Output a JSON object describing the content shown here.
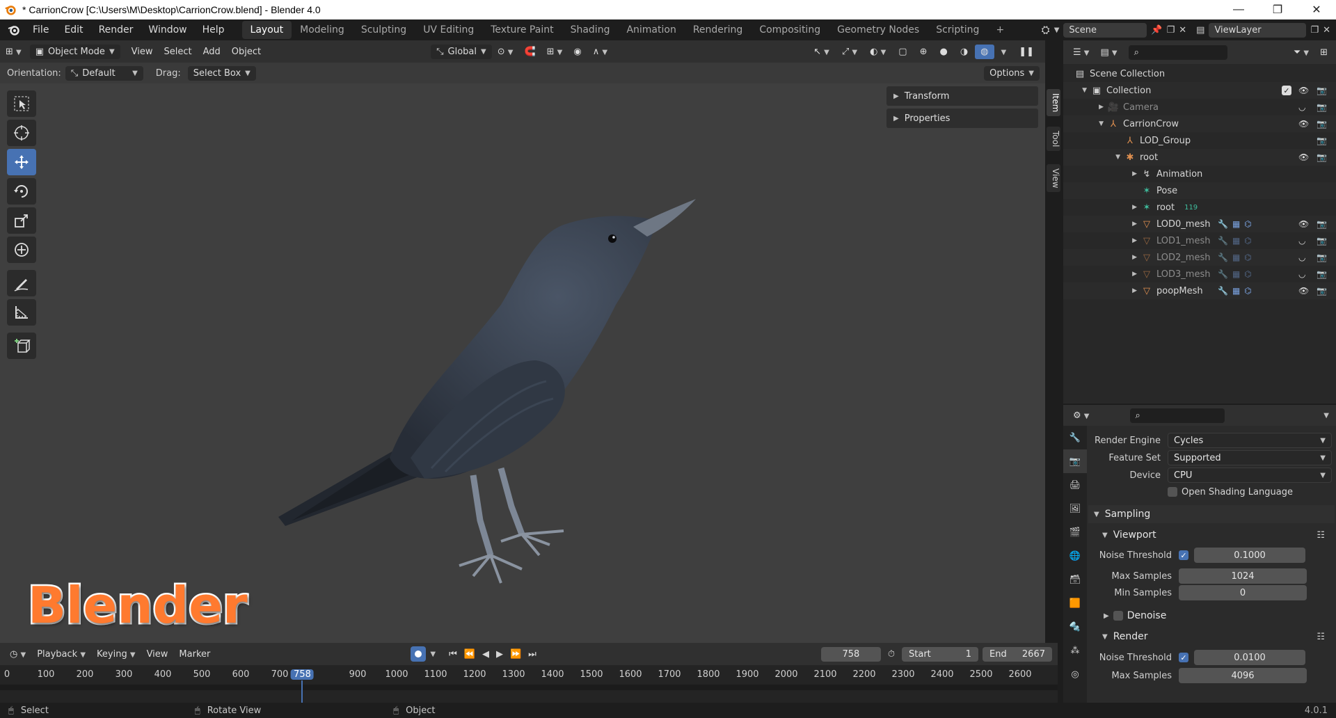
{
  "window": {
    "title": "* CarrionCrow [C:\\Users\\M\\Desktop\\CarrionCrow.blend] - Blender 4.0",
    "minimize": "—",
    "maximize": "❐",
    "close": "✕"
  },
  "menu": [
    "File",
    "Edit",
    "Render",
    "Window",
    "Help"
  ],
  "workspaces": [
    "Layout",
    "Modeling",
    "Sculpting",
    "UV Editing",
    "Texture Paint",
    "Shading",
    "Animation",
    "Rendering",
    "Compositing",
    "Geometry Nodes",
    "Scripting"
  ],
  "active_workspace": "Layout",
  "add_workspace": "+",
  "scene": {
    "name": "Scene",
    "view_layer": "ViewLayer"
  },
  "viewport": {
    "mode": "Object Mode",
    "menus": [
      "View",
      "Select",
      "Add",
      "Object"
    ],
    "transform_orientation": "Global",
    "orientation_label": "Orientation:",
    "orientation_value": "Default",
    "drag_label": "Drag:",
    "drag_value": "Select Box",
    "options": "Options",
    "panels": [
      "Transform",
      "Properties"
    ],
    "side_tabs": [
      "Item",
      "Tool",
      "View"
    ],
    "watermark": "Blender"
  },
  "timeline": {
    "menus": [
      "Playback",
      "Keying",
      "View",
      "Marker"
    ],
    "current_frame": "758",
    "start_label": "Start",
    "start_value": "1",
    "end_label": "End",
    "end_value": "2667",
    "ruler_labels": [
      "0",
      "100",
      "200",
      "300",
      "400",
      "500",
      "600",
      "700",
      "758",
      "900",
      "1000",
      "1100",
      "1200",
      "1300",
      "1400",
      "1500",
      "1600",
      "1700",
      "1800",
      "1900",
      "2000",
      "2100",
      "2200",
      "2300",
      "2400",
      "2500",
      "2600"
    ],
    "ruler_frames": [
      0,
      100,
      200,
      300,
      400,
      500,
      600,
      700,
      758,
      900,
      1000,
      1100,
      1200,
      1300,
      1400,
      1500,
      1600,
      1700,
      1800,
      1900,
      2000,
      2100,
      2200,
      2300,
      2400,
      2500,
      2600
    ]
  },
  "statusbar": {
    "left": "Select",
    "middle": "Rotate View",
    "right": "Object",
    "version": "4.0.1"
  },
  "outliner": {
    "rows": [
      {
        "name": "Scene Collection",
        "indent": 0,
        "icon": "scene-collection-icon",
        "muted": false
      },
      {
        "name": "Collection",
        "indent": 1,
        "icon": "collection-icon",
        "muted": false
      },
      {
        "name": "Camera",
        "indent": 2,
        "icon": "camera-icon",
        "muted": true
      },
      {
        "name": "CarrionCrow",
        "indent": 2,
        "icon": "empty-icon",
        "muted": false
      },
      {
        "name": "LOD_Group",
        "indent": 3,
        "icon": "empty-icon",
        "muted": false
      },
      {
        "name": "root",
        "indent": 3,
        "icon": "armature-icon",
        "muted": false
      },
      {
        "name": "Animation",
        "indent": 4,
        "icon": "animation-icon",
        "muted": false
      },
      {
        "name": "Pose",
        "indent": 4,
        "icon": "pose-icon",
        "muted": false
      },
      {
        "name": "root",
        "indent": 4,
        "icon": "armature-data-icon",
        "muted": false,
        "badge": "119"
      },
      {
        "name": "LOD0_mesh",
        "indent": 4,
        "icon": "mesh-icon",
        "muted": false
      },
      {
        "name": "LOD1_mesh",
        "indent": 4,
        "icon": "mesh-icon",
        "muted": true
      },
      {
        "name": "LOD2_mesh",
        "indent": 4,
        "icon": "mesh-icon",
        "muted": true
      },
      {
        "name": "LOD3_mesh",
        "indent": 4,
        "icon": "mesh-icon",
        "muted": true
      },
      {
        "name": "poopMesh",
        "indent": 4,
        "icon": "mesh-icon",
        "muted": false
      }
    ]
  },
  "properties": {
    "render_engine_label": "Render Engine",
    "render_engine": "Cycles",
    "feature_set_label": "Feature Set",
    "feature_set": "Supported",
    "device_label": "Device",
    "device": "CPU",
    "osl_label": "Open Shading Language",
    "sampling": "Sampling",
    "viewport": "Viewport",
    "noise_threshold_label": "Noise Threshold",
    "viewport_noise_threshold": "0.1000",
    "max_samples_label": "Max Samples",
    "viewport_max_samples": "1024",
    "min_samples_label": "Min Samples",
    "viewport_min_samples": "0",
    "denoise": "Denoise",
    "render": "Render",
    "render_noise_threshold": "0.0100",
    "render_max_samples_label": "Max Samples",
    "render_max_samples": "4096"
  },
  "colors": {
    "accent": "#4772b3",
    "watermark_fill": "#ff7a2f",
    "mesh_icon": "#e09050",
    "armature_icon": "#e09050",
    "pose_icon": "#3fbf9f"
  }
}
